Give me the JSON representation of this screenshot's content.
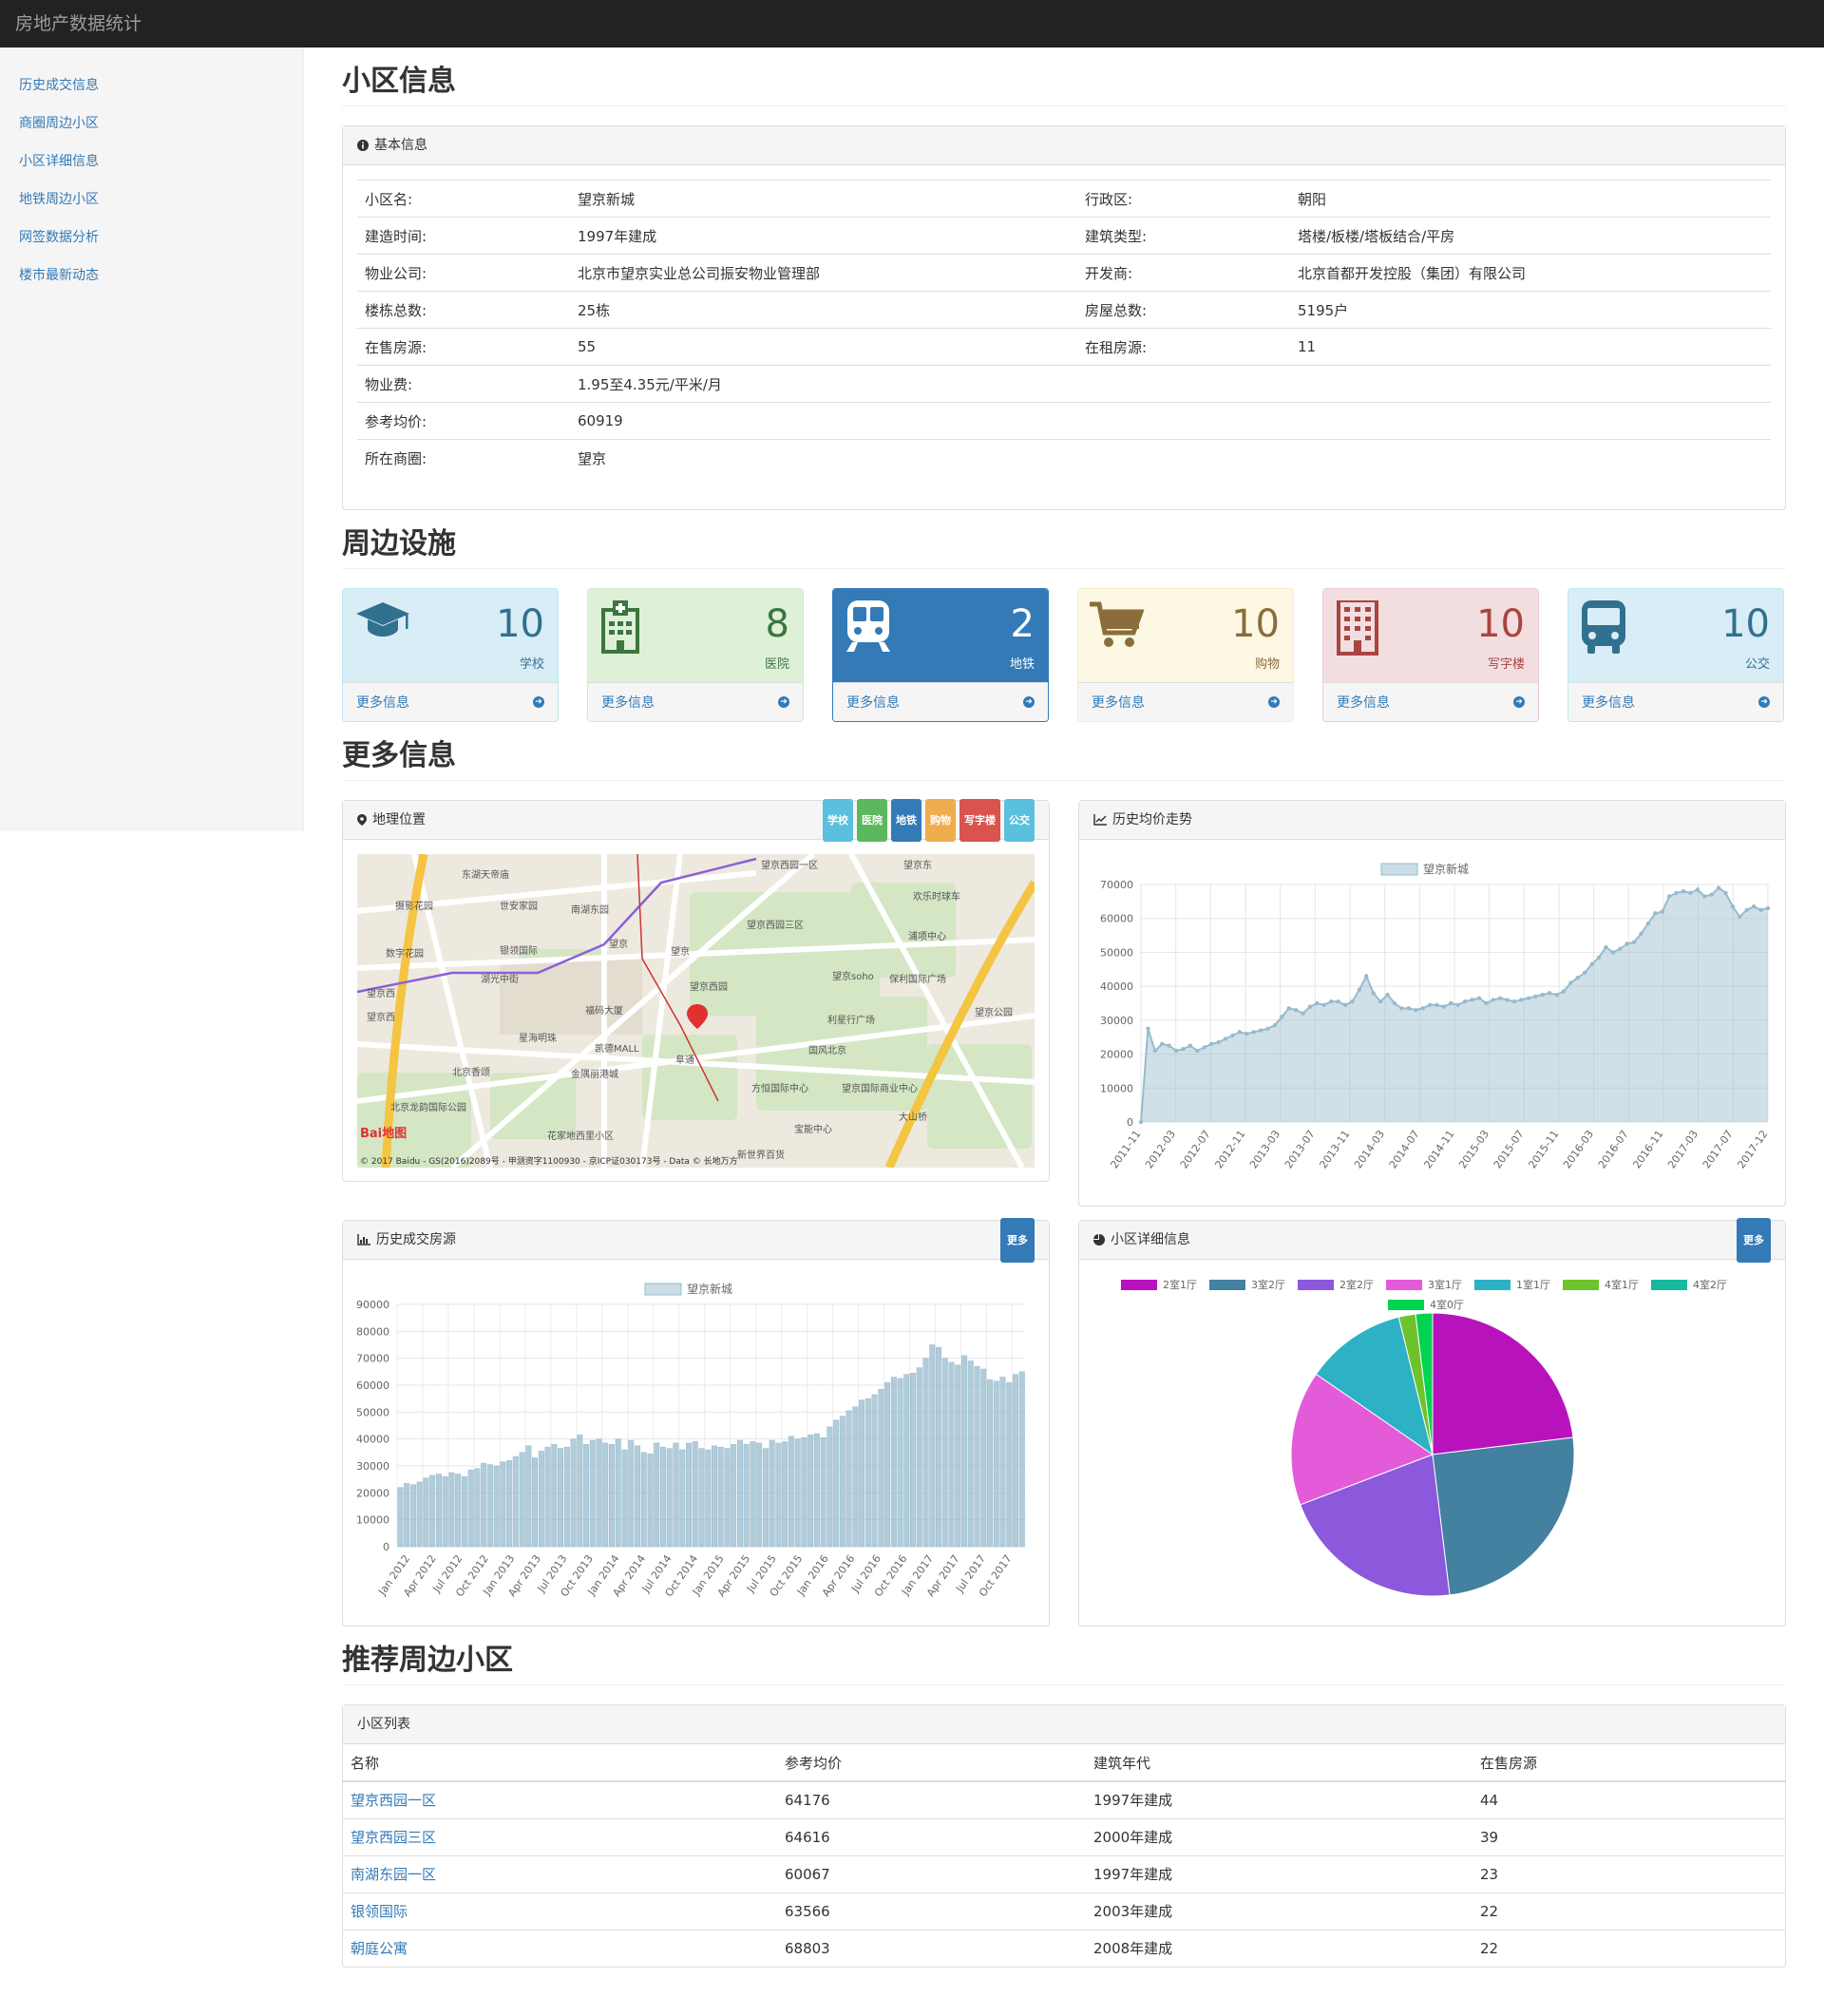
{
  "app_title": "房地产数据统计",
  "sidebar": {
    "items": [
      {
        "label": "历史成交信息"
      },
      {
        "label": "商圈周边小区"
      },
      {
        "label": "小区详细信息"
      },
      {
        "label": "地铁周边小区"
      },
      {
        "label": "网签数据分析"
      },
      {
        "label": "楼市最新动态"
      }
    ]
  },
  "section_info": "小区信息",
  "basic_panel_title": "基本信息",
  "basic_info": [
    {
      "k1": "小区名:",
      "v1": "望京新城",
      "k2": "行政区:",
      "v2": "朝阳"
    },
    {
      "k1": "建造时间:",
      "v1": "1997年建成",
      "k2": "建筑类型:",
      "v2": "塔楼/板楼/塔板结合/平房"
    },
    {
      "k1": "物业公司:",
      "v1": "北京市望京实业总公司振安物业管理部",
      "k2": "开发商:",
      "v2": "北京首都开发控股（集团）有限公司"
    },
    {
      "k1": "楼栋总数:",
      "v1": "25栋",
      "k2": "房屋总数:",
      "v2": "5195户"
    },
    {
      "k1": "在售房源:",
      "v1": "55",
      "k2": "在租房源:",
      "v2": "11"
    },
    {
      "k1": "物业费:",
      "v1": "1.95至4.35元/平米/月",
      "k2": "",
      "v2": ""
    },
    {
      "k1": "参考均价:",
      "v1": "60919",
      "k2": "",
      "v2": ""
    },
    {
      "k1": "所在商圈:",
      "v1": "望京",
      "k2": "",
      "v2": ""
    }
  ],
  "section_facilities": "周边设施",
  "facilities": [
    {
      "count": "10",
      "label": "学校",
      "more": "更多信息",
      "icon": "graduation-cap-icon",
      "bg": "#d9edf7",
      "border": "#bce8f1",
      "fg": "#31708f"
    },
    {
      "count": "8",
      "label": "医院",
      "more": "更多信息",
      "icon": "hospital-icon",
      "bg": "#dff0d8",
      "border": "#d6e9c6",
      "fg": "#3c763d"
    },
    {
      "count": "2",
      "label": "地铁",
      "more": "更多信息",
      "icon": "subway-icon",
      "bg": "#337ab7",
      "border": "#337ab7",
      "fg": "#ffffff"
    },
    {
      "count": "10",
      "label": "购物",
      "more": "更多信息",
      "icon": "cart-icon",
      "bg": "#fcf8e3",
      "border": "#faebcc",
      "fg": "#8a6d3b"
    },
    {
      "count": "10",
      "label": "写字楼",
      "more": "更多信息",
      "icon": "building-icon",
      "bg": "#f2dede",
      "border": "#ebccd1",
      "fg": "#a94442"
    },
    {
      "count": "10",
      "label": "公交",
      "more": "更多信息",
      "icon": "bus-icon",
      "bg": "#d9edf7",
      "border": "#bce8f1",
      "fg": "#31708f"
    }
  ],
  "section_more": "更多信息",
  "map_panel": {
    "title": "地理位置",
    "badges": [
      {
        "label": "学校",
        "color": "#5bc0de"
      },
      {
        "label": "医院",
        "color": "#5cb85c"
      },
      {
        "label": "地铁",
        "color": "#337ab7"
      },
      {
        "label": "购物",
        "color": "#f0ad4e"
      },
      {
        "label": "写字楼",
        "color": "#d9534f"
      },
      {
        "label": "公交",
        "color": "#5bc0de"
      }
    ],
    "labels": [
      "东湖天帝庙",
      "望京西园一区",
      "望京东",
      "摄影花园",
      "世安家园",
      "南湖东园",
      "望京西园三区",
      "欢乐时球车",
      "数字花园",
      "银领国际",
      "望京",
      "望京",
      "湖光中街",
      "望京西",
      "望京西",
      "望京soho",
      "保利国际广场",
      "福码大厦",
      "望京西园",
      "浦项中心",
      "星海明珠",
      "凯德MALL",
      "利星行广场",
      "北京香颂",
      "金隅丽港城",
      "阜通",
      "国风北京",
      "北京龙韵国际公园",
      "方恒国际中心",
      "望京国际商业中心",
      "大山桥",
      "花家地西里小区",
      "宝能中心",
      "新世界百货",
      "望京公园"
    ],
    "copyright": "© 2017 Baidu - GS(2016)2089号 - 甲测资字1100930 - 京ICP证030173号 - Data © 长地万方",
    "logo": "Bai地图"
  },
  "trend_panel": {
    "title": "历史均价走势"
  },
  "deal_panel": {
    "title": "历史成交房源",
    "more": "更多"
  },
  "detail_panel": {
    "title": "小区详细信息",
    "more": "更多"
  },
  "chart_data": [
    {
      "type": "line",
      "legend": "望京新城",
      "ylim": [
        0,
        70000
      ],
      "yticks": [
        0,
        10000,
        20000,
        30000,
        40000,
        50000,
        60000,
        70000
      ],
      "xticks": [
        "2011-11",
        "2012-03",
        "2012-07",
        "2012-11",
        "2013-03",
        "2013-07",
        "2013-11",
        "2014-03",
        "2014-07",
        "2014-11",
        "2015-03",
        "2015-07",
        "2015-11",
        "2016-03",
        "2016-07",
        "2016-11",
        "2017-03",
        "2017-07",
        "2017-12"
      ],
      "series": [
        {
          "name": "望京新城",
          "values": [
            0,
            27500,
            21000,
            23000,
            22500,
            21000,
            21500,
            22500,
            21000,
            22000,
            23000,
            23500,
            24500,
            25500,
            26500,
            26000,
            26500,
            27000,
            27500,
            28500,
            31000,
            33500,
            33000,
            32000,
            34000,
            35000,
            34500,
            35500,
            35500,
            34500,
            35500,
            39000,
            43000,
            38000,
            35500,
            37500,
            35000,
            33500,
            33500,
            33000,
            33500,
            34500,
            34500,
            34000,
            35000,
            34500,
            35500,
            36000,
            36500,
            35000,
            36000,
            36500,
            36000,
            35500,
            36000,
            36500,
            37000,
            37500,
            38000,
            37500,
            38500,
            41000,
            42500,
            44000,
            46500,
            48500,
            51500,
            50000,
            51000,
            52500,
            53000,
            55500,
            58500,
            61500,
            62000,
            66500,
            67500,
            68000,
            67500,
            68500,
            66500,
            67000,
            69000,
            67500,
            63500,
            60500,
            62500,
            63500,
            62500,
            63000
          ]
        }
      ]
    },
    {
      "type": "bar",
      "legend": "望京新城",
      "ylim": [
        0,
        90000
      ],
      "yticks": [
        0,
        10000,
        20000,
        30000,
        40000,
        50000,
        60000,
        70000,
        80000,
        90000
      ],
      "xticks": [
        "Jan 2012",
        "Apr 2012",
        "Jul 2012",
        "Oct 2012",
        "Jan 2013",
        "Apr 2013",
        "Jul 2013",
        "Oct 2013",
        "Jan 2014",
        "Apr 2014",
        "Jul 2014",
        "Oct 2014",
        "Jan 2015",
        "Apr 2015",
        "Jul 2015",
        "Oct 2015",
        "Jan 2016",
        "Apr 2016",
        "Jul 2016",
        "Oct 2016",
        "Jan 2017",
        "Apr 2017",
        "Jul 2017",
        "Oct 2017"
      ],
      "series": [
        {
          "name": "望京新城",
          "values": [
            22000,
            23500,
            23000,
            24000,
            25500,
            26500,
            27000,
            26000,
            27500,
            27000,
            26000,
            28500,
            29000,
            31000,
            30500,
            30000,
            31500,
            32000,
            33500,
            35000,
            37500,
            33000,
            35500,
            37000,
            38000,
            36500,
            37000,
            40000,
            41500,
            38000,
            39500,
            40000,
            38500,
            38000,
            40000,
            36000,
            39500,
            37500,
            35000,
            34500,
            38500,
            37000,
            36500,
            38500,
            36000,
            38500,
            39000,
            36500,
            36000,
            37500,
            37000,
            36500,
            38000,
            39500,
            38000,
            39000,
            38500,
            36500,
            39500,
            38500,
            39000,
            41000,
            40000,
            40500,
            41500,
            42000,
            40500,
            44500,
            47000,
            48500,
            50500,
            52000,
            54500,
            55000,
            56500,
            58500,
            61000,
            63000,
            62500,
            64000,
            64500,
            66500,
            70000,
            75000,
            74000,
            70000,
            68500,
            67500,
            71000,
            69000,
            67000,
            66000,
            62000,
            61500,
            63000,
            61000,
            64000,
            65000
          ]
        }
      ]
    },
    {
      "type": "pie",
      "legend_position": "top",
      "categories": [
        "2室1厅",
        "3室2厅",
        "2室2厅",
        "3室1厅",
        "1室1厅",
        "4室1厅",
        "4室2厅",
        "4室0厅"
      ],
      "values": [
        12,
        13,
        11,
        8,
        6,
        1,
        0,
        1
      ],
      "colors": [
        "#b812bd",
        "#44809f",
        "#8c58dc",
        "#e35bd8",
        "#2db1c4",
        "#6ec32c",
        "#17b99b",
        "#00d350"
      ]
    }
  ],
  "section_recommend": "推荐周边小区",
  "list_panel_title": "小区列表",
  "list_headers": [
    "名称",
    "参考均价",
    "建筑年代",
    "在售房源"
  ],
  "list_rows": [
    [
      "望京西园一区",
      "64176",
      "1997年建成",
      "44"
    ],
    [
      "望京西园三区",
      "64616",
      "2000年建成",
      "39"
    ],
    [
      "南湖东园一区",
      "60067",
      "1997年建成",
      "23"
    ],
    [
      "银领国际",
      "63566",
      "2003年建成",
      "22"
    ],
    [
      "朝庭公寓",
      "68803",
      "2008年建成",
      "22"
    ]
  ]
}
